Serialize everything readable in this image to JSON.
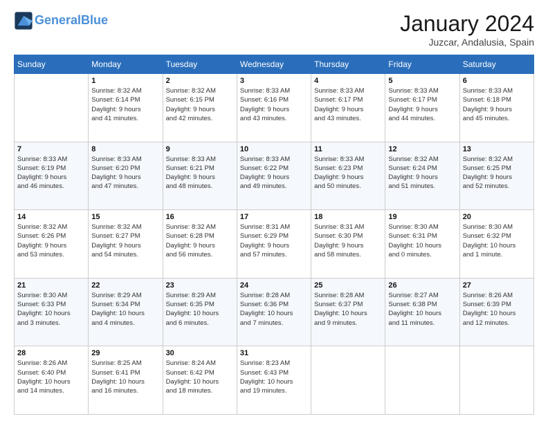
{
  "header": {
    "logo_line1": "General",
    "logo_line2": "Blue",
    "month_title": "January 2024",
    "location": "Juzcar, Andalusia, Spain"
  },
  "days_of_week": [
    "Sunday",
    "Monday",
    "Tuesday",
    "Wednesday",
    "Thursday",
    "Friday",
    "Saturday"
  ],
  "weeks": [
    [
      {
        "day": "",
        "info": ""
      },
      {
        "day": "1",
        "info": "Sunrise: 8:32 AM\nSunset: 6:14 PM\nDaylight: 9 hours\nand 41 minutes."
      },
      {
        "day": "2",
        "info": "Sunrise: 8:32 AM\nSunset: 6:15 PM\nDaylight: 9 hours\nand 42 minutes."
      },
      {
        "day": "3",
        "info": "Sunrise: 8:33 AM\nSunset: 6:16 PM\nDaylight: 9 hours\nand 43 minutes."
      },
      {
        "day": "4",
        "info": "Sunrise: 8:33 AM\nSunset: 6:17 PM\nDaylight: 9 hours\nand 43 minutes."
      },
      {
        "day": "5",
        "info": "Sunrise: 8:33 AM\nSunset: 6:17 PM\nDaylight: 9 hours\nand 44 minutes."
      },
      {
        "day": "6",
        "info": "Sunrise: 8:33 AM\nSunset: 6:18 PM\nDaylight: 9 hours\nand 45 minutes."
      }
    ],
    [
      {
        "day": "7",
        "info": "Sunrise: 8:33 AM\nSunset: 6:19 PM\nDaylight: 9 hours\nand 46 minutes."
      },
      {
        "day": "8",
        "info": "Sunrise: 8:33 AM\nSunset: 6:20 PM\nDaylight: 9 hours\nand 47 minutes."
      },
      {
        "day": "9",
        "info": "Sunrise: 8:33 AM\nSunset: 6:21 PM\nDaylight: 9 hours\nand 48 minutes."
      },
      {
        "day": "10",
        "info": "Sunrise: 8:33 AM\nSunset: 6:22 PM\nDaylight: 9 hours\nand 49 minutes."
      },
      {
        "day": "11",
        "info": "Sunrise: 8:33 AM\nSunset: 6:23 PM\nDaylight: 9 hours\nand 50 minutes."
      },
      {
        "day": "12",
        "info": "Sunrise: 8:32 AM\nSunset: 6:24 PM\nDaylight: 9 hours\nand 51 minutes."
      },
      {
        "day": "13",
        "info": "Sunrise: 8:32 AM\nSunset: 6:25 PM\nDaylight: 9 hours\nand 52 minutes."
      }
    ],
    [
      {
        "day": "14",
        "info": "Sunrise: 8:32 AM\nSunset: 6:26 PM\nDaylight: 9 hours\nand 53 minutes."
      },
      {
        "day": "15",
        "info": "Sunrise: 8:32 AM\nSunset: 6:27 PM\nDaylight: 9 hours\nand 54 minutes."
      },
      {
        "day": "16",
        "info": "Sunrise: 8:32 AM\nSunset: 6:28 PM\nDaylight: 9 hours\nand 56 minutes."
      },
      {
        "day": "17",
        "info": "Sunrise: 8:31 AM\nSunset: 6:29 PM\nDaylight: 9 hours\nand 57 minutes."
      },
      {
        "day": "18",
        "info": "Sunrise: 8:31 AM\nSunset: 6:30 PM\nDaylight: 9 hours\nand 58 minutes."
      },
      {
        "day": "19",
        "info": "Sunrise: 8:30 AM\nSunset: 6:31 PM\nDaylight: 10 hours\nand 0 minutes."
      },
      {
        "day": "20",
        "info": "Sunrise: 8:30 AM\nSunset: 6:32 PM\nDaylight: 10 hours\nand 1 minute."
      }
    ],
    [
      {
        "day": "21",
        "info": "Sunrise: 8:30 AM\nSunset: 6:33 PM\nDaylight: 10 hours\nand 3 minutes."
      },
      {
        "day": "22",
        "info": "Sunrise: 8:29 AM\nSunset: 6:34 PM\nDaylight: 10 hours\nand 4 minutes."
      },
      {
        "day": "23",
        "info": "Sunrise: 8:29 AM\nSunset: 6:35 PM\nDaylight: 10 hours\nand 6 minutes."
      },
      {
        "day": "24",
        "info": "Sunrise: 8:28 AM\nSunset: 6:36 PM\nDaylight: 10 hours\nand 7 minutes."
      },
      {
        "day": "25",
        "info": "Sunrise: 8:28 AM\nSunset: 6:37 PM\nDaylight: 10 hours\nand 9 minutes."
      },
      {
        "day": "26",
        "info": "Sunrise: 8:27 AM\nSunset: 6:38 PM\nDaylight: 10 hours\nand 11 minutes."
      },
      {
        "day": "27",
        "info": "Sunrise: 8:26 AM\nSunset: 6:39 PM\nDaylight: 10 hours\nand 12 minutes."
      }
    ],
    [
      {
        "day": "28",
        "info": "Sunrise: 8:26 AM\nSunset: 6:40 PM\nDaylight: 10 hours\nand 14 minutes."
      },
      {
        "day": "29",
        "info": "Sunrise: 8:25 AM\nSunset: 6:41 PM\nDaylight: 10 hours\nand 16 minutes."
      },
      {
        "day": "30",
        "info": "Sunrise: 8:24 AM\nSunset: 6:42 PM\nDaylight: 10 hours\nand 18 minutes."
      },
      {
        "day": "31",
        "info": "Sunrise: 8:23 AM\nSunset: 6:43 PM\nDaylight: 10 hours\nand 19 minutes."
      },
      {
        "day": "",
        "info": ""
      },
      {
        "day": "",
        "info": ""
      },
      {
        "day": "",
        "info": ""
      }
    ]
  ]
}
